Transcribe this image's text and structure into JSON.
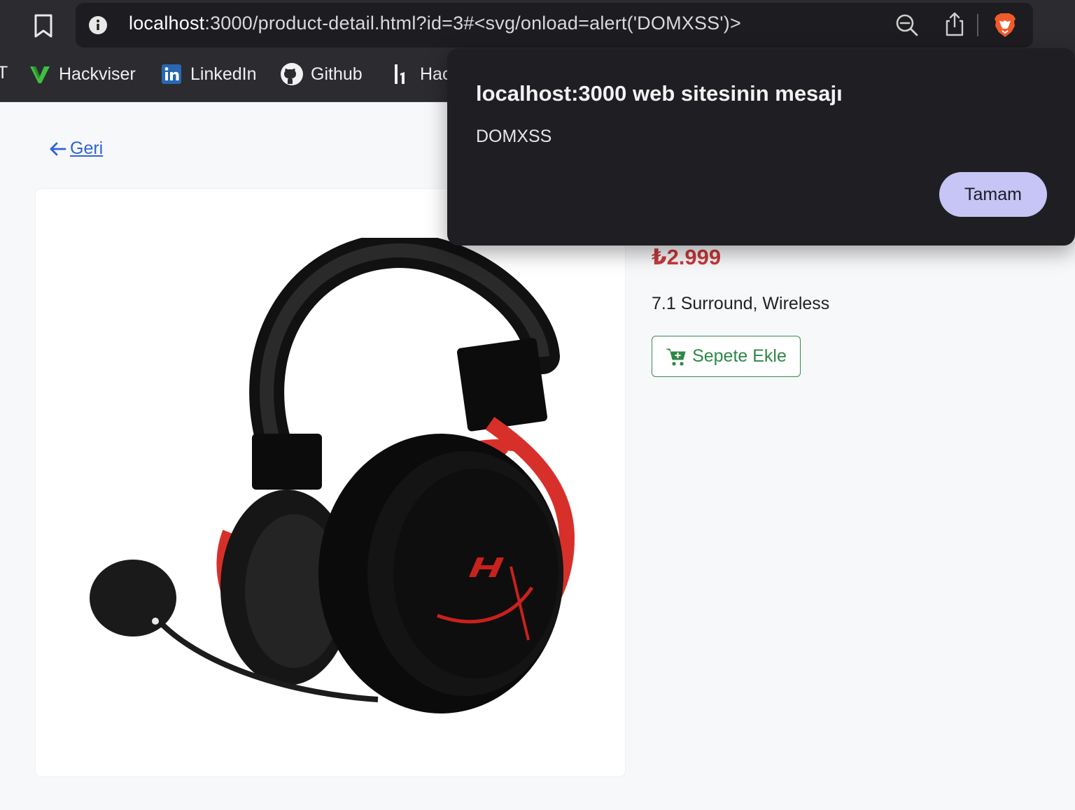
{
  "browser": {
    "url_host": "localhost",
    "url_rest": ":3000/product-detail.html?id=3#<svg/onload=alert('DOMXSS')>",
    "icons": [
      "bookmark-icon",
      "info-icon",
      "zoom-out-icon",
      "share-icon",
      "brave-icon"
    ]
  },
  "bookmarks": {
    "partial_first": "T",
    "items": [
      {
        "label": "Hackviser",
        "icon": "hackviser-icon"
      },
      {
        "label": "LinkedIn",
        "icon": "linkedin-icon"
      },
      {
        "label": "Github",
        "icon": "github-icon"
      },
      {
        "label": "Hac",
        "icon": "hackerone-icon"
      }
    ]
  },
  "page": {
    "back_label": "Geri",
    "price": "₺2.999",
    "description": "7.1 Surround, Wireless",
    "cart_label": "Sepete Ekle"
  },
  "dialog": {
    "title": "localhost:3000 web sitesinin mesajı",
    "message": "DOMXSS",
    "ok_label": "Tamam"
  },
  "colors": {
    "accent_link": "#2e64d8",
    "price": "#c73a3a",
    "cart_green": "#2f8746",
    "dialog_button": "#c7c4f6"
  }
}
